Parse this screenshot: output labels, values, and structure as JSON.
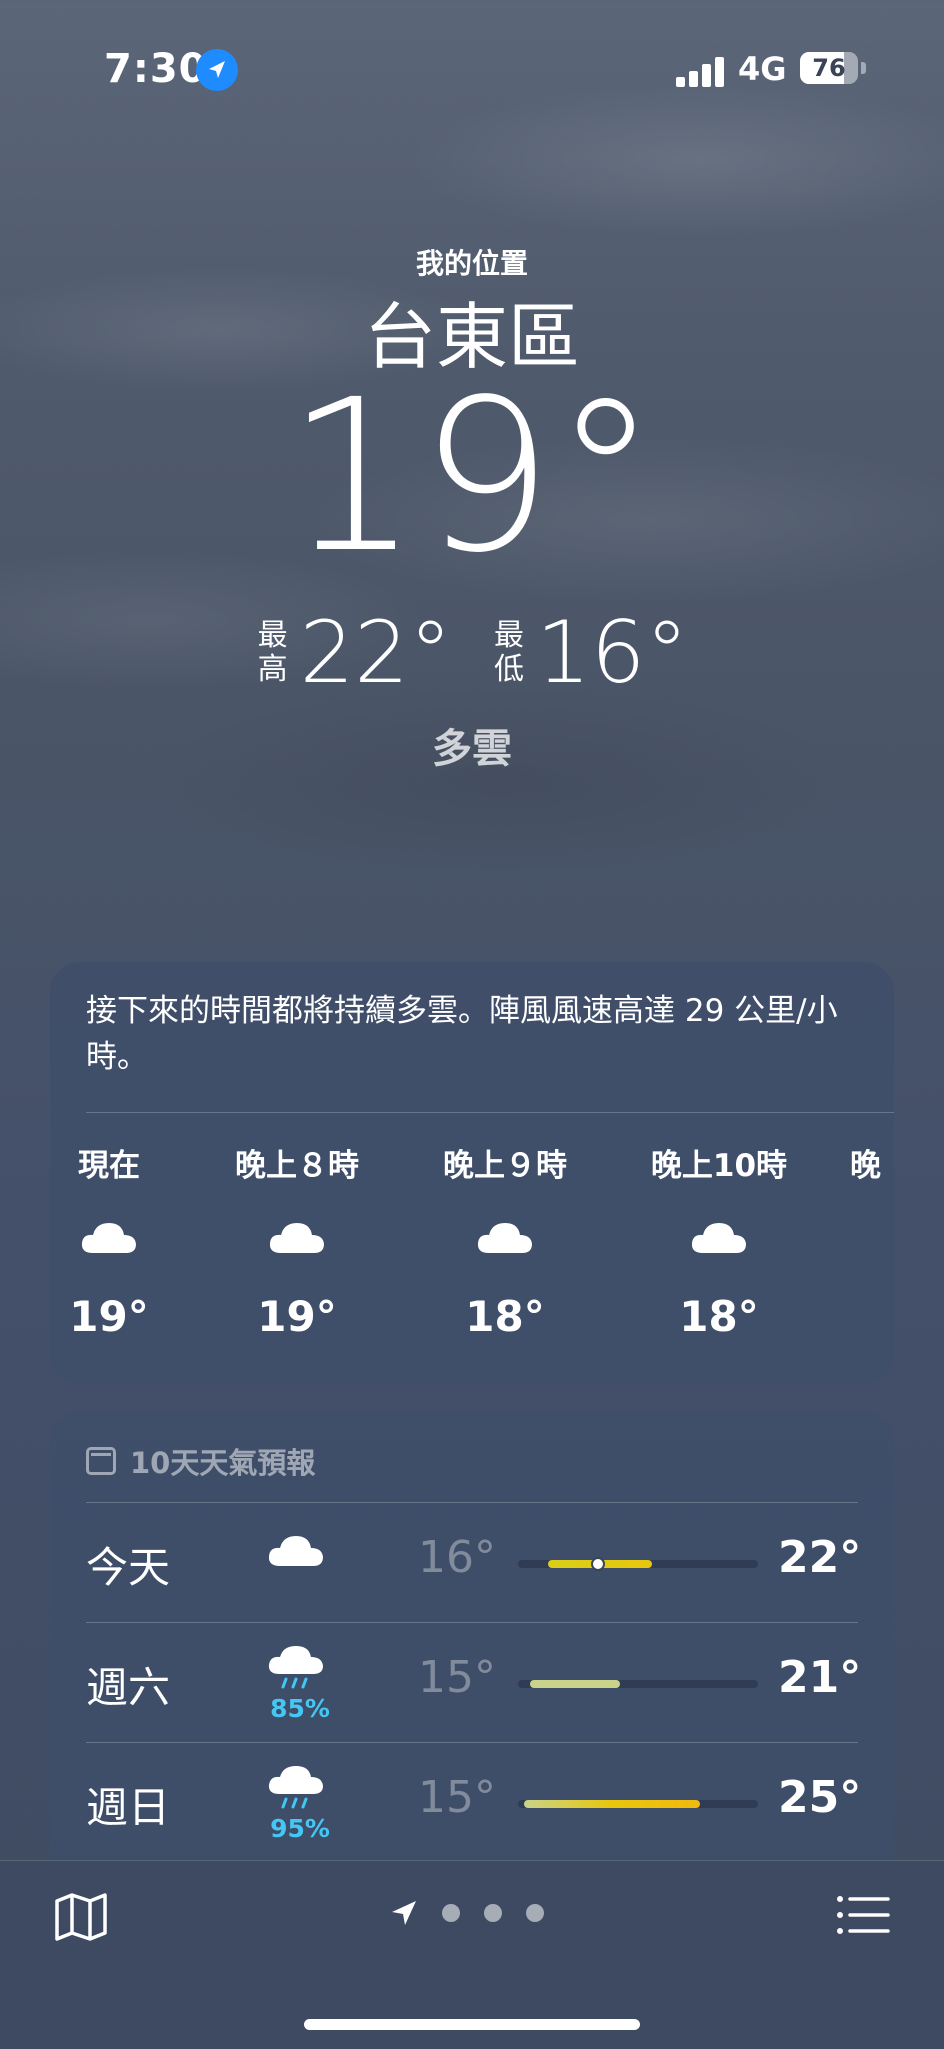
{
  "status": {
    "time": "7:30",
    "network": "4G",
    "battery": "76",
    "battery_level": 0.76
  },
  "header": {
    "my_location": "我的位置",
    "city": "台東區",
    "temperature": "19°",
    "high_label": "最高",
    "high": "22°",
    "low_label": "最低",
    "low": "16°",
    "condition": "多雲"
  },
  "hourly": {
    "summary": "接下來的時間都將持續多雲。陣風風速高達 29 公里/小時。",
    "items": [
      {
        "label": "現在",
        "icon": "cloud-icon",
        "temp": "19°"
      },
      {
        "label": "晚上８時",
        "icon": "cloud-icon",
        "temp": "19°"
      },
      {
        "label": "晚上９時",
        "icon": "cloud-icon",
        "temp": "18°"
      },
      {
        "label": "晚上10時",
        "icon": "cloud-icon",
        "temp": "18°"
      },
      {
        "label": "晚",
        "icon": "cloud-icon",
        "temp": ""
      }
    ]
  },
  "forecast": {
    "title": "10天天氣預報",
    "days": [
      {
        "day": "今天",
        "icon": "cloud-icon",
        "precip": "",
        "low": "16°",
        "high": "22°"
      },
      {
        "day": "週六",
        "icon": "rain-cloud-icon",
        "precip": "85%",
        "low": "15°",
        "high": "21°"
      },
      {
        "day": "週日",
        "icon": "rain-cloud-icon",
        "precip": "95%",
        "low": "15°",
        "high": "25°"
      }
    ]
  },
  "colors": {
    "accent_blue": "#1e8cff",
    "precip_blue": "#45c7f5",
    "bar_yellow": "#e8c60c",
    "bar_green": "#c9d48a",
    "bar_orange": "#f2b90f"
  }
}
